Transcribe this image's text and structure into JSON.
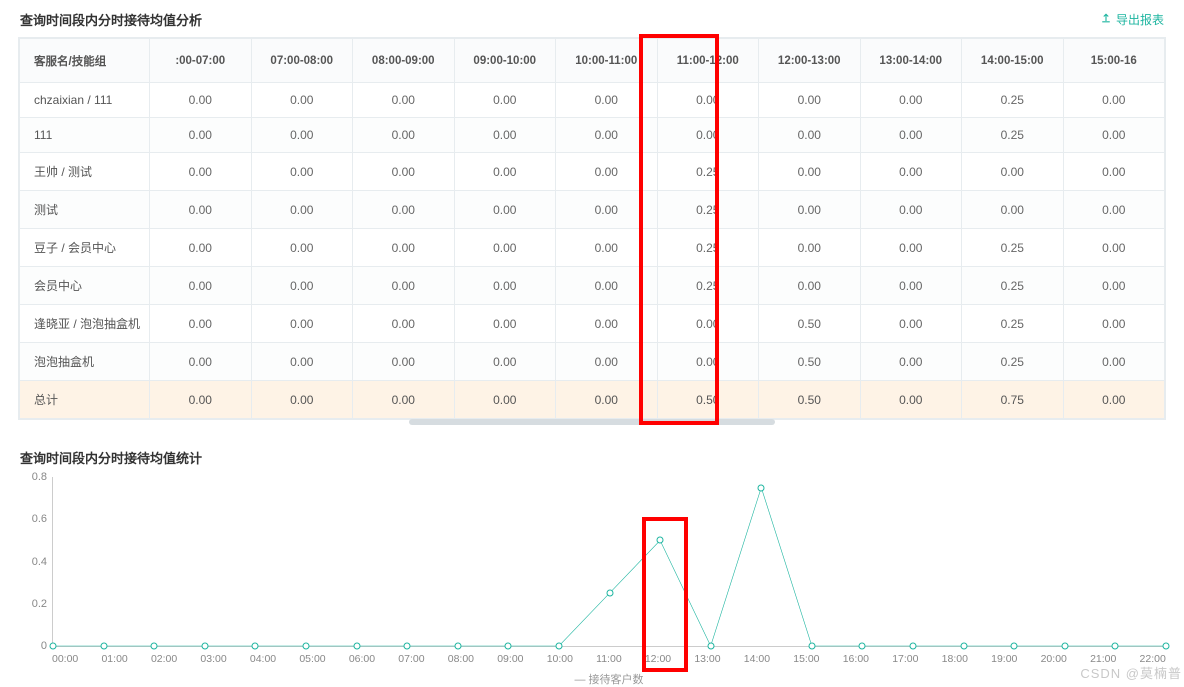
{
  "section1": {
    "title": "查询时间段内分时接待均值分析",
    "export_label": "导出报表"
  },
  "table": {
    "name_header": "客服名/技能组",
    "time_headers": [
      ":00-07:00",
      "07:00-08:00",
      "08:00-09:00",
      "09:00-10:00",
      "10:00-11:00",
      "11:00-12:00",
      "12:00-13:00",
      "13:00-14:00",
      "14:00-15:00",
      "15:00-16"
    ],
    "rows": [
      {
        "name": "chzaixian / 111",
        "vals": [
          "0.00",
          "0.00",
          "0.00",
          "0.00",
          "0.00",
          "0.00",
          "0.00",
          "0.00",
          "0.25",
          "0.00"
        ]
      },
      {
        "name": "111",
        "vals": [
          "0.00",
          "0.00",
          "0.00",
          "0.00",
          "0.00",
          "0.00",
          "0.00",
          "0.00",
          "0.25",
          "0.00"
        ]
      },
      {
        "name": "王帅 / 测试",
        "vals": [
          "0.00",
          "0.00",
          "0.00",
          "0.00",
          "0.00",
          "0.25",
          "0.00",
          "0.00",
          "0.00",
          "0.00"
        ]
      },
      {
        "name": "测试",
        "vals": [
          "0.00",
          "0.00",
          "0.00",
          "0.00",
          "0.00",
          "0.25",
          "0.00",
          "0.00",
          "0.00",
          "0.00"
        ]
      },
      {
        "name": "豆子 / 会员中心",
        "vals": [
          "0.00",
          "0.00",
          "0.00",
          "0.00",
          "0.00",
          "0.25",
          "0.00",
          "0.00",
          "0.25",
          "0.00"
        ]
      },
      {
        "name": "会员中心",
        "vals": [
          "0.00",
          "0.00",
          "0.00",
          "0.00",
          "0.00",
          "0.25",
          "0.00",
          "0.00",
          "0.25",
          "0.00"
        ]
      },
      {
        "name": "逢晓亚 / 泡泡抽盒机",
        "vals": [
          "0.00",
          "0.00",
          "0.00",
          "0.00",
          "0.00",
          "0.00",
          "0.50",
          "0.00",
          "0.25",
          "0.00"
        ]
      },
      {
        "name": "泡泡抽盒机",
        "vals": [
          "0.00",
          "0.00",
          "0.00",
          "0.00",
          "0.00",
          "0.00",
          "0.50",
          "0.00",
          "0.25",
          "0.00"
        ]
      }
    ],
    "total": {
      "name": "总计",
      "vals": [
        "0.00",
        "0.00",
        "0.00",
        "0.00",
        "0.00",
        "0.50",
        "0.50",
        "0.00",
        "0.75",
        "0.00"
      ]
    }
  },
  "section2": {
    "title": "查询时间段内分时接待均值统计",
    "legend": "接待客户数"
  },
  "chart_data": {
    "type": "line",
    "title": "查询时间段内分时接待均值统计",
    "xlabel": "",
    "ylabel": "",
    "ylim": [
      0,
      0.8
    ],
    "y_ticks": [
      0,
      0.2,
      0.4,
      0.6,
      0.8
    ],
    "x": [
      "00:00",
      "01:00",
      "02:00",
      "03:00",
      "04:00",
      "05:00",
      "06:00",
      "07:00",
      "08:00",
      "09:00",
      "10:00",
      "11:00",
      "12:00",
      "13:00",
      "14:00",
      "15:00",
      "16:00",
      "17:00",
      "18:00",
      "19:00",
      "20:00",
      "21:00",
      "22:00"
    ],
    "series": [
      {
        "name": "接待客户数",
        "color": "#1db5a0",
        "values": [
          0,
          0,
          0,
          0,
          0,
          0,
          0,
          0,
          0,
          0,
          0,
          0.25,
          0.5,
          0,
          0.75,
          0,
          0,
          0,
          0,
          0,
          0,
          0,
          0
        ]
      }
    ]
  },
  "watermark": "CSDN @莫楠普"
}
